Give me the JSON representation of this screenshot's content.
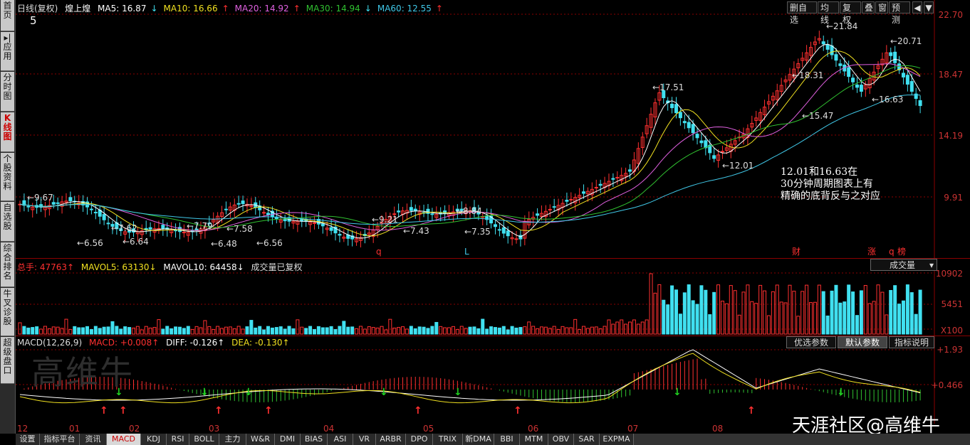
{
  "sidebar": {
    "items": [
      {
        "label": "首页"
      },
      {
        "label": "▸|应用"
      },
      {
        "label": "分时图"
      },
      {
        "label": "K线图"
      },
      {
        "label": "个股资料"
      },
      {
        "label": "自选股"
      },
      {
        "label": "综合排名"
      },
      {
        "label": "牛叉诊股"
      },
      {
        "label": "超级盘口"
      }
    ]
  },
  "price_panel": {
    "period_label": "日线(复权)",
    "stock_name": "煌上煌",
    "ma": [
      {
        "name": "MA5",
        "value": "16.87",
        "arrow": "↓",
        "color": "#ffffff"
      },
      {
        "name": "MA10",
        "value": "16.66",
        "arrow": "↑",
        "color": "#f0e020"
      },
      {
        "name": "MA20",
        "value": "14.92",
        "arrow": "↑",
        "color": "#e060e0"
      },
      {
        "name": "MA30",
        "value": "14.94",
        "arrow": "↓",
        "color": "#30c030"
      },
      {
        "name": "MA60",
        "value": "12.55",
        "arrow": "↑",
        "color": "#40c8e8"
      }
    ],
    "digit": "5",
    "axis": [
      "22.70",
      "18.47",
      "14.19",
      "9.91"
    ],
    "annotations": {
      "low1": "6.56",
      "low2": "6.64",
      "low3": "6.48",
      "low4": "6.56",
      "p962": "9.67",
      "p762": "7.62",
      "p779": "7.79",
      "p758": "7.58",
      "p921": "9.21",
      "p743": "7.43",
      "p884": "8.84",
      "p735": "7.35",
      "p1751": "17.51",
      "p1201": "12.01",
      "p1831": "18.31",
      "p2184": "21.84",
      "p1547": "15.47",
      "p2071": "20.71",
      "p1663": "16.63"
    },
    "markers": [
      "q",
      "L",
      "财",
      "涨",
      "q",
      "榜"
    ],
    "note": "12.01和16.63在\n30分钟周期图表上有\n精确的底背反与之对应",
    "toolbar": [
      "删自选",
      "均线",
      "复权",
      "叠",
      "窗",
      "预测"
    ]
  },
  "volume_panel": {
    "total_label": "总手: 47763↑",
    "mavol5": "MAVOL5: 63130↓",
    "mavol10": "MAVOL10: 64458↓",
    "note": "成交量已复权",
    "selector": "成交量",
    "axis": [
      "10902",
      "5451",
      "X100"
    ]
  },
  "macd_panel": {
    "title": "MACD(12,26,9)",
    "macd": "MACD: +0.008↑",
    "diff": "DIFF: -0.126↑",
    "dea": "DEA: -0.130↑",
    "buttons": [
      "优选参数",
      "默认参数",
      "指标说明"
    ],
    "axis": [
      "+1.93",
      "+0.466"
    ],
    "watermark": "高维牛"
  },
  "months": [
    "12",
    "01",
    "02",
    "03",
    "04",
    "05",
    "06",
    "07",
    "08"
  ],
  "tabs": [
    "设置",
    "指标平台",
    "资讯",
    "MACD",
    "KDJ",
    "RSI",
    "BOLL",
    "主力",
    "W&R",
    "DMI",
    "BIAS",
    "ASI",
    "VR",
    "ARBR",
    "DPO",
    "TRIX",
    "新DMA",
    "BBI",
    "MTM",
    "OBV",
    "SAR",
    "EXPMA"
  ],
  "site_watermark": "天涯社区@高维牛",
  "colors": {
    "up": "#ff3030",
    "down": "#40e0f0",
    "grid": "#8b0000",
    "ma5": "#ffffff",
    "ma10": "#f0e020",
    "ma20": "#e060e0",
    "ma30": "#30c030",
    "ma60": "#40c8e8"
  }
}
